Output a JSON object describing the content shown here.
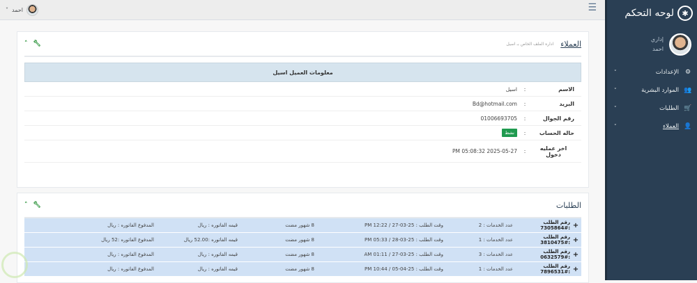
{
  "sidebar": {
    "brand": "لوحه التحكم",
    "role": "إداري",
    "name": "احمد",
    "items": [
      {
        "label": "الإعدادات",
        "icon": "cogs-icon"
      },
      {
        "label": "الموارد البشرية",
        "icon": "users-icon"
      },
      {
        "label": "الطلبات",
        "icon": "cart-icon"
      },
      {
        "label": "العملاء",
        "icon": "user-icon"
      }
    ]
  },
  "topbar": {
    "username": "احمد"
  },
  "customer_panel": {
    "title": "العملاء",
    "subtitle": "اداره الملف الخاص بـ اسيل",
    "info_title": "معلومات العميل اسيل",
    "rows": [
      {
        "label": "الاسم",
        "value": "اسيل"
      },
      {
        "label": "البريد",
        "value": "Bd@hotmail.com"
      },
      {
        "label": "رقم الجوال",
        "value": "01006693705"
      },
      {
        "label": "حاله الحساب",
        "value": "نشط"
      },
      {
        "label": "اخر عمليه دخول",
        "value": "PM 05:08:32 2025-05-27"
      }
    ],
    "colon": ":"
  },
  "orders_panel": {
    "title": "الطلبات",
    "orders": [
      {
        "id": "رقم الطلب :#7305864",
        "services": "عدد الخدمات : 2",
        "time": "وقت الطلب : 25-03-27 / 12:22 PM",
        "ago": "8 شهور مضت",
        "invoice": "قيمه الفاتوره : ريال",
        "paid": "المدفوع الفاتوره : ريال"
      },
      {
        "id": "رقم الطلب :#3810475",
        "services": "عدد الخدمات : 1",
        "time": "وقت الطلب : 25-03-28 / 05:33 PM",
        "ago": "8 شهور مضت",
        "invoice": "قيمه الفاتوره :52.00 ريال",
        "paid": "المدفوع الفاتوره :52 ريال"
      },
      {
        "id": "رقم الطلب :#0632579",
        "services": "عدد الخدمات : 3",
        "time": "وقت الطلب : 25-03-27 / 01:11 AM",
        "ago": "8 شهور مضت",
        "invoice": "قيمه الفاتوره : ريال",
        "paid": "المدفوع الفاتوره : ريال"
      },
      {
        "id": "رقم الطلب :#7896531",
        "services": "عدد الخدمات : 1",
        "time": "وقت الطلب : 25-04-05 / 10:44 PM",
        "ago": "8 شهور مضت",
        "invoice": "قيمه الفاتوره : ريال",
        "paid": "المدفوع الفاتوره : ريال"
      }
    ]
  }
}
